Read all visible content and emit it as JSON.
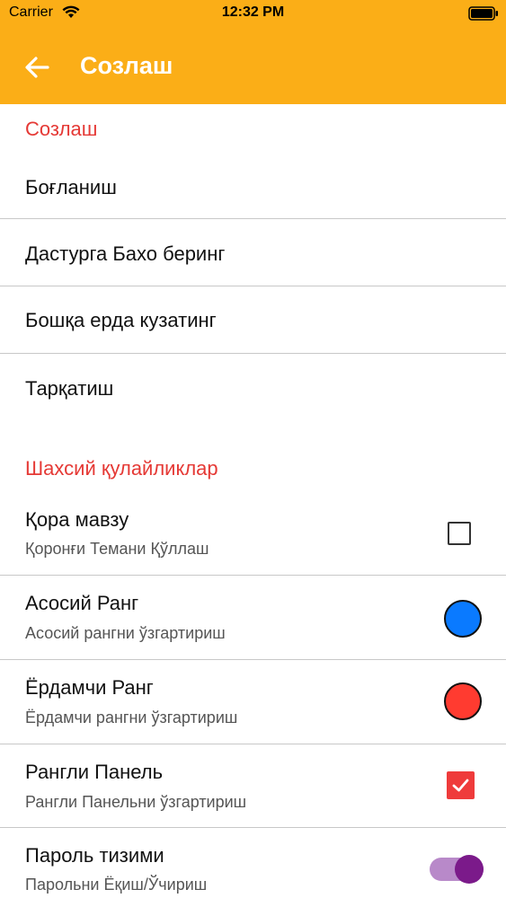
{
  "status_bar": {
    "carrier": "Carrier",
    "time": "12:32 PM"
  },
  "header": {
    "title": "Созлаш",
    "background_color": "#FBAE17"
  },
  "sections": {
    "settings": {
      "header": "Созлаш",
      "items": [
        {
          "label": "Боғланиш"
        },
        {
          "label": "Дастурга Бахо беринг"
        },
        {
          "label": "Бошқа ерда кузатинг"
        },
        {
          "label": "Тарқатиш"
        }
      ]
    },
    "preferences": {
      "header": "Шахсий қулайликлар",
      "items": [
        {
          "label": "Қора мавзу",
          "sub": "Қоронғи Темани Қўллаш",
          "control": "checkbox",
          "checked": false
        },
        {
          "label": "Асосий Ранг",
          "sub": "Асосий рангни ўзгартириш",
          "control": "color",
          "color": "#0A7AFF"
        },
        {
          "label": "Ёрдамчи Ранг",
          "sub": "Ёрдамчи рангни ўзгартириш",
          "control": "color",
          "color": "#FF3B30"
        },
        {
          "label": "Рангли Панель",
          "sub": "Рангли Панельни ўзгартириш",
          "control": "checkbox",
          "checked": true
        },
        {
          "label": "Пароль тизими",
          "sub": "Парольни Ёқиш/Ўчириш",
          "control": "toggle",
          "on": true
        }
      ]
    }
  },
  "accent_colors": {
    "section_header": "#E53935",
    "checkbox_checked": "#EF3B3B",
    "toggle_track": "#B889C9",
    "toggle_thumb": "#7B1A8A"
  }
}
